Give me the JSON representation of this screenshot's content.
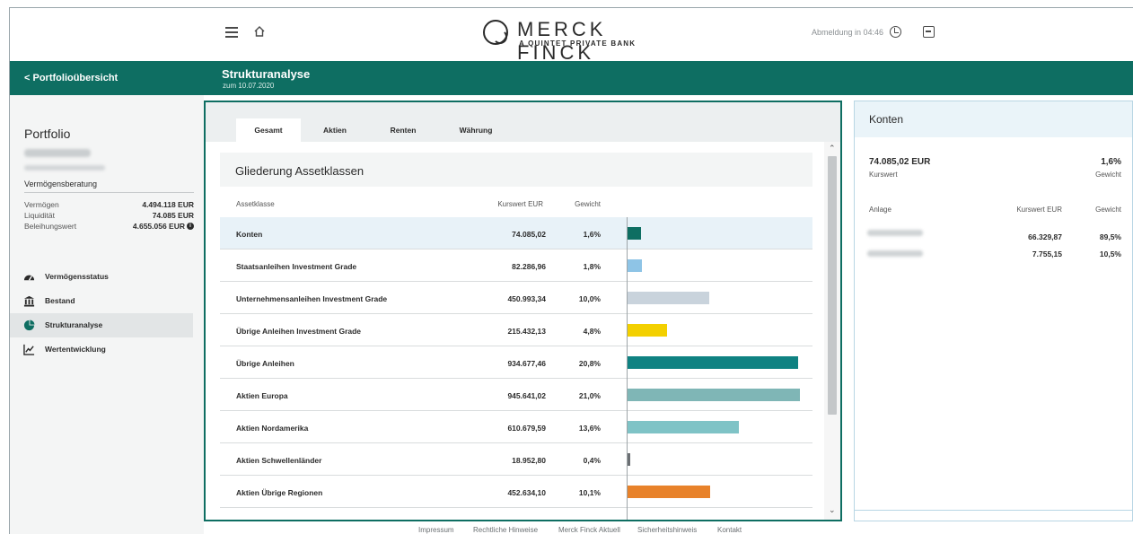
{
  "header": {
    "logo_name": "MERCK FINCK",
    "logo_tagline": "A QUINTET PRIVATE BANK",
    "logout_timer": "Abmeldung in 04:46"
  },
  "subheader": {
    "back_label": "Portfolioübersicht",
    "title": "Strukturanalyse",
    "subtitle": "zum 10.07.2020"
  },
  "sidebar": {
    "heading": "Portfolio",
    "portfolio_type": "Vermögensberatung",
    "facts": [
      {
        "label": "Vermögen",
        "value": "4.494.118 EUR"
      },
      {
        "label": "Liquidität",
        "value": "74.085 EUR"
      },
      {
        "label": "Beleihungswert",
        "value": "4.655.056 EUR"
      }
    ],
    "nav": [
      {
        "label": "Vermögensstatus",
        "icon": "gauge-icon",
        "active": false
      },
      {
        "label": "Bestand",
        "icon": "bank-icon",
        "active": false
      },
      {
        "label": "Strukturanalyse",
        "icon": "pie-chart-icon",
        "active": true
      },
      {
        "label": "Wertentwicklung",
        "icon": "line-chart-icon",
        "active": false
      }
    ]
  },
  "tabs": [
    "Gesamt",
    "Aktien",
    "Renten",
    "Währung"
  ],
  "card": {
    "title": "Gliederung Assetklassen",
    "col_asset": "Assetklasse",
    "col_value": "Kurswert EUR",
    "col_weight": "Gewicht"
  },
  "chart_data": {
    "type": "table",
    "columns": [
      "Assetklasse",
      "Kurswert EUR",
      "Gewicht"
    ],
    "rows": [
      {
        "category": "Konten",
        "value": "74.085,02",
        "weight": "1,6%",
        "weight_num": 1.6,
        "color": "#0e6e62"
      },
      {
        "category": "Staatsanleihen Investment Grade",
        "value": "82.286,96",
        "weight": "1,8%",
        "weight_num": 1.8,
        "color": "#8ec4e6"
      },
      {
        "category": "Unternehmensanleihen Investment Grade",
        "value": "450.993,34",
        "weight": "10,0%",
        "weight_num": 10.0,
        "color": "#c9d3dc"
      },
      {
        "category": "Übrige Anleihen Investment Grade",
        "value": "215.432,13",
        "weight": "4,8%",
        "weight_num": 4.8,
        "color": "#f3d000"
      },
      {
        "category": "Übrige Anleihen",
        "value": "934.677,46",
        "weight": "20,8%",
        "weight_num": 20.8,
        "color": "#0f8282"
      },
      {
        "category": "Aktien Europa",
        "value": "945.641,02",
        "weight": "21,0%",
        "weight_num": 21.0,
        "color": "#7fb6b6"
      },
      {
        "category": "Aktien Nordamerika",
        "value": "610.679,59",
        "weight": "13,6%",
        "weight_num": 13.6,
        "color": "#7fc3c6"
      },
      {
        "category": "Aktien Schwellenländer",
        "value": "18.952,80",
        "weight": "0,4%",
        "weight_num": 0.4,
        "color": "#6b6f73"
      },
      {
        "category": "Aktien Übrige Regionen",
        "value": "452.634,10",
        "weight": "10,1%",
        "weight_num": 10.1,
        "color": "#e8822a"
      }
    ]
  },
  "konten": {
    "title": "Konten",
    "amount": "74.085,02 EUR",
    "amount_label": "Kurswert",
    "weight": "1,6%",
    "weight_label": "Gewicht",
    "col_anlage": "Anlage",
    "col_value": "Kurswert EUR",
    "col_weight": "Gewicht",
    "rows": [
      {
        "value": "66.329,87",
        "weight": "89,5%"
      },
      {
        "value": "7.755,15",
        "weight": "10,5%"
      }
    ]
  },
  "footer": [
    "Impressum",
    "Rechtliche Hinweise",
    "Merck Finck Aktuell",
    "Sicherheitshinweis",
    "Kontakt"
  ]
}
